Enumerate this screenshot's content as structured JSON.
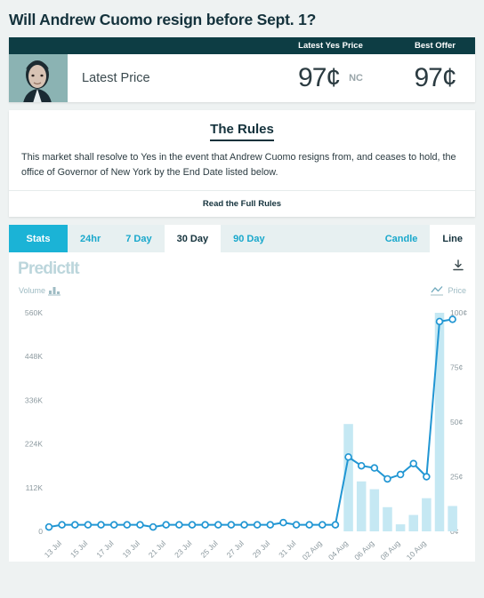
{
  "page": {
    "title": "Will Andrew Cuomo resign before Sept. 1?"
  },
  "price_card": {
    "col_yes_label": "Latest Yes Price",
    "col_best_label": "Best Offer",
    "row_label": "Latest Price",
    "yes_price": "97¢",
    "change": "NC",
    "best_offer": "97¢"
  },
  "rules": {
    "heading": "The Rules",
    "body": "This market shall resolve to Yes in the event that Andrew Cuomo resigns from, and ceases to hold, the office of Governor of New York by the End Date listed below.",
    "full_rules_link": "Read the Full Rules"
  },
  "tabs": {
    "stats": "Stats",
    "ranges": [
      "24hr",
      "7 Day",
      "30 Day",
      "90 Day"
    ],
    "active_range": "30 Day",
    "types": [
      "Candle",
      "Line"
    ],
    "active_type": "Line"
  },
  "chart_panel": {
    "logo": "PredictIt",
    "volume_legend": "Volume",
    "price_legend": "Price",
    "download_icon": "download-icon",
    "volume_icon": "bar-chart-icon",
    "price_icon": "line-chart-icon"
  },
  "colors": {
    "brand_dark_teal": "#0d3d44",
    "accent_cyan": "#1bb3d6",
    "link_cyan": "#19a8cc",
    "line_blue": "#2196d3",
    "bar_fill": "#c5e8f3",
    "page_bg": "#eef2f2",
    "logo_gray": "#bcd6dc"
  },
  "chart_data": {
    "type": "line",
    "title": "",
    "xlabel": "",
    "ylabel": "Volume",
    "y2label": "Price",
    "grid": false,
    "legend_position": "top",
    "ylim": [
      0,
      560000
    ],
    "y2lim": [
      0,
      100
    ],
    "yticks": [
      0,
      112000,
      224000,
      336000,
      448000,
      560000
    ],
    "ytick_labels": [
      "0",
      "112K",
      "224K",
      "336K",
      "448K",
      "560K"
    ],
    "y2ticks": [
      0,
      25,
      50,
      75,
      100
    ],
    "y2tick_labels": [
      "0¢",
      "25¢",
      "50¢",
      "75¢",
      "100¢"
    ],
    "x": [
      "12 Jul",
      "13 Jul",
      "14 Jul",
      "15 Jul",
      "16 Jul",
      "17 Jul",
      "18 Jul",
      "19 Jul",
      "20 Jul",
      "21 Jul",
      "22 Jul",
      "23 Jul",
      "24 Jul",
      "25 Jul",
      "26 Jul",
      "27 Jul",
      "28 Jul",
      "29 Jul",
      "30 Jul",
      "31 Jul",
      "01 Aug",
      "02 Aug",
      "03 Aug",
      "04 Aug",
      "05 Aug",
      "06 Aug",
      "07 Aug",
      "08 Aug",
      "09 Aug",
      "10 Aug",
      "11 Aug"
    ],
    "xtick_labels": [
      "13 Jul",
      "15 Jul",
      "17 Jul",
      "19 Jul",
      "21 Jul",
      "23 Jul",
      "25 Jul",
      "27 Jul",
      "29 Jul",
      "31 Jul",
      "02 Aug",
      "04 Aug",
      "06 Aug",
      "08 Aug",
      "10 Aug"
    ],
    "xtick_indices": [
      1,
      3,
      5,
      7,
      9,
      11,
      13,
      15,
      17,
      19,
      21,
      23,
      25,
      27,
      29
    ],
    "series": [
      {
        "name": "Price",
        "type": "line",
        "axis": "right",
        "unit": "¢",
        "color": "#2196d3",
        "values": [
          2,
          3,
          3,
          3,
          3,
          3,
          3,
          3,
          2,
          3,
          3,
          3,
          3,
          3,
          3,
          3,
          3,
          3,
          4,
          3,
          3,
          3,
          3,
          34,
          30,
          29,
          24,
          26,
          31,
          25,
          96,
          97
        ]
      },
      {
        "name": "Volume",
        "type": "bar",
        "axis": "left",
        "color": "#c5e8f3",
        "values": [
          0,
          0,
          0,
          0,
          0,
          0,
          0,
          0,
          0,
          0,
          0,
          0,
          0,
          0,
          0,
          0,
          0,
          0,
          0,
          0,
          0,
          0,
          0,
          275000,
          128000,
          108000,
          62000,
          18000,
          42000,
          85000,
          560000,
          65000
        ]
      }
    ]
  }
}
